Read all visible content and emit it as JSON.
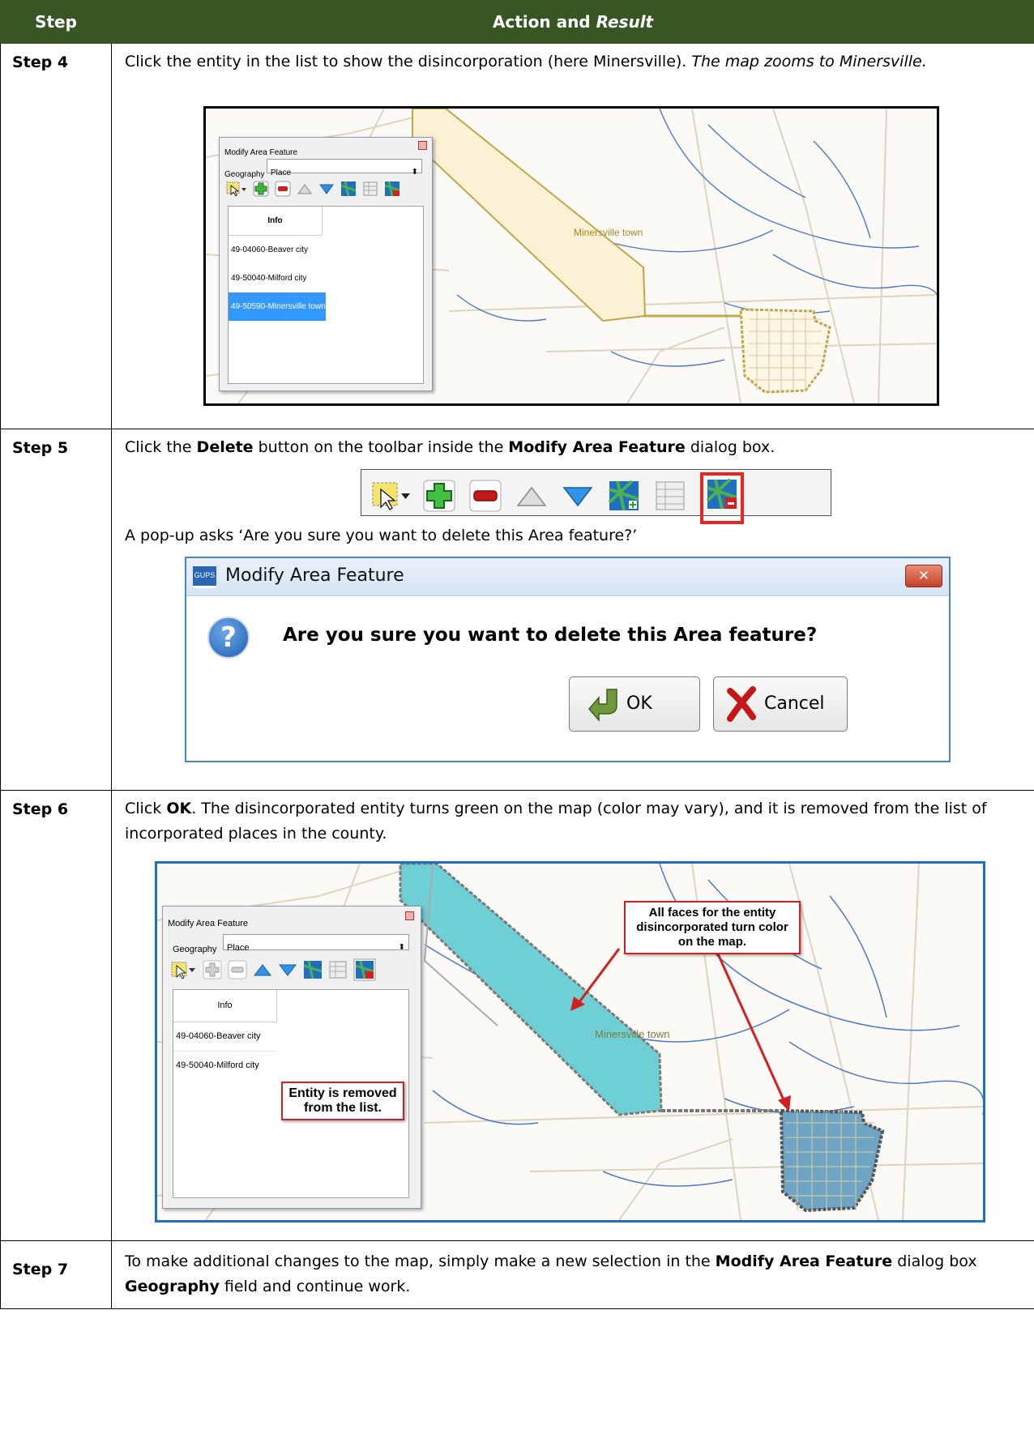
{
  "table": {
    "header_step": "Step",
    "header_action": "Action and ",
    "header_result": "Result"
  },
  "step4": {
    "label": "Step 4",
    "text": "Click the entity in the list to show the disincorporation (here Minersville). ",
    "italic": "The map zooms to Minersville.",
    "map_place_label": "Minersville town"
  },
  "step5": {
    "label": "Step 5",
    "t1": "Click the ",
    "b1": "Delete",
    "t2": " button on the toolbar inside the ",
    "b2": "Modify Area Feature",
    "t3": " dialog box.",
    "popup_text": "A pop-up asks ‘Are you sure you want to delete this Area feature?’",
    "popup": {
      "badge": "GUPS",
      "title": "Modify Area Feature",
      "question": "Are you sure you want to delete this Area feature?",
      "ok": "OK",
      "cancel": "Cancel"
    }
  },
  "step6": {
    "label": "Step 6",
    "t1": "Click ",
    "b1": "OK",
    "t2": ". The disincorporated entity turns green on the map (color may vary), and it is removed from the list of incorporated places in the county.",
    "callout_faces": "All faces for the entity disincorporated turn color on the map.",
    "callout_removed": "Entity is removed from the list.",
    "map_place_label": "Minersville town"
  },
  "step7": {
    "label": "Step 7",
    "t1": "To make additional changes to the map, simply make a new selection in the ",
    "b1": "Modify Area Feature",
    "t2": " dialog box ",
    "b2": "Geography",
    "t3": " field and continue work."
  },
  "dialog": {
    "title": "Modify Area Feature",
    "geography_label": "Geography",
    "geography_value": "Place",
    "list_header": "Info",
    "items_before": [
      "49-04060-Beaver city",
      "49-50040-Milford city",
      "49-50590-Minersville town"
    ],
    "items_after": [
      "49-04060-Beaver city",
      "49-50040-Milford city"
    ]
  },
  "colors": {
    "header_bg": "#375623",
    "highlight": "#e8261f",
    "selected": "#3399ff",
    "place_fill": "#fbf1d4",
    "disincorporated_fill": "#6ecfd4"
  }
}
